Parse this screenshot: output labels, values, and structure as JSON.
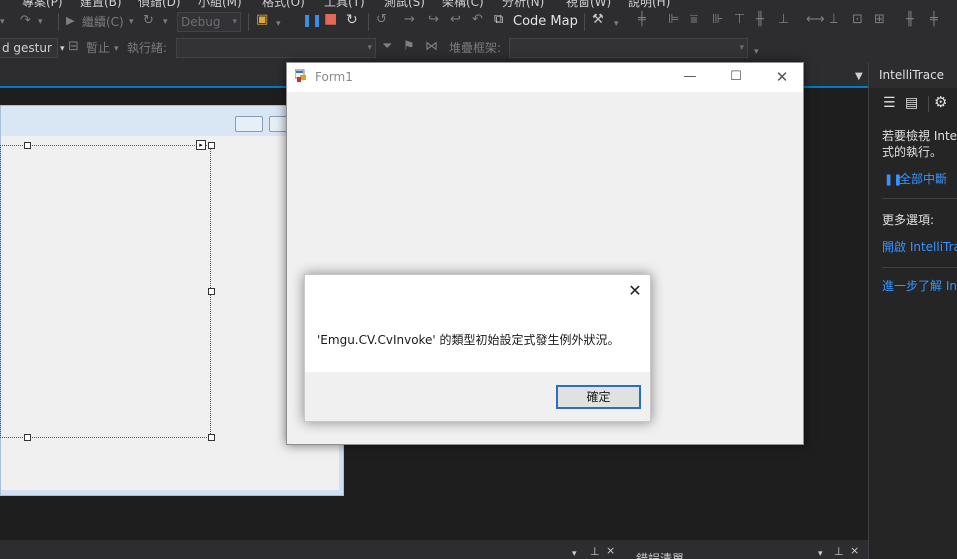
{
  "menubar": {
    "items": [
      "專案(P)",
      "建置(B)",
      "偵錯(D)",
      "小組(M)",
      "格式(O)",
      "工具(T)",
      "測試(S)",
      "架構(C)",
      "分析(N)",
      "視窗(W)",
      "說明(H)"
    ]
  },
  "toolbar1": {
    "continue_label": "繼續(C)",
    "config_value": "Debug",
    "codemap_label": "Code Map"
  },
  "toolbar2": {
    "target_combo_value": "d gestur",
    "stop_label": "暫止",
    "thread_label": "執行緒:",
    "stackframe_label": "堆疊框架:"
  },
  "intellitrace": {
    "title": "IntelliTrace",
    "info_text_1": "若要檢視 Intel",
    "info_text_2": "式的執行。",
    "break_all_link": "全部中斷",
    "more_options_label": "更多選項:",
    "open_link": "開啟 IntelliTra",
    "learn_more_link": "進一步了解 In"
  },
  "bottom_panel": {
    "error_list_title": "錯誤清單"
  },
  "form1": {
    "title": "Form1"
  },
  "messagebox": {
    "message": "'Emgu.CV.CvInvoke' 的類型初始設定式發生例外狀況。",
    "ok_label": "確定"
  },
  "colors": {
    "accent": "#007acc",
    "link": "#3794ff",
    "ok_border": "#2a6fc2"
  }
}
